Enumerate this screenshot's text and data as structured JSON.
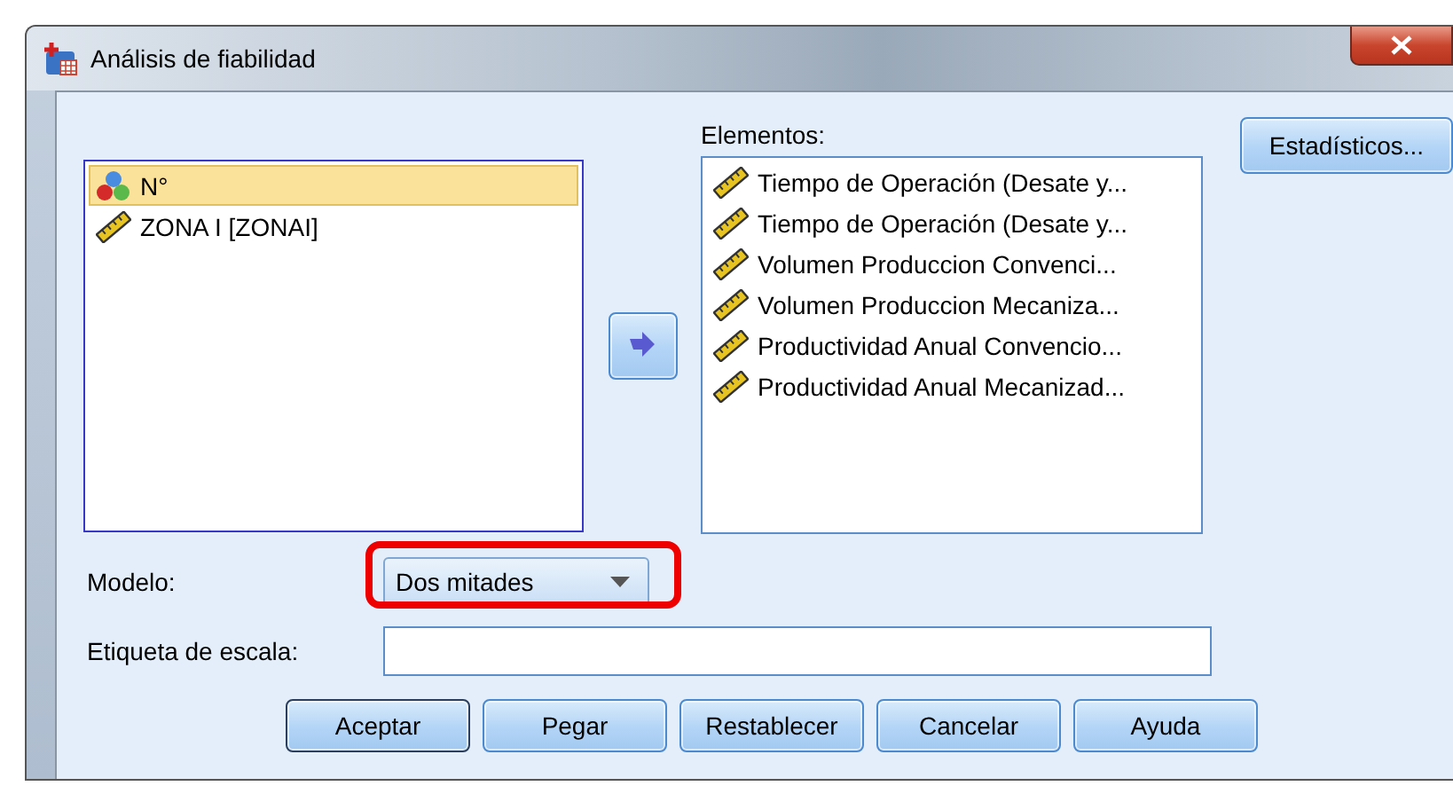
{
  "window": {
    "title": "Análisis de fiabilidad"
  },
  "variables": [
    {
      "label": "N°",
      "kind": "nominal",
      "selected": true
    },
    {
      "label": "ZONA I [ZONAI]",
      "kind": "scale",
      "selected": false
    }
  ],
  "items": {
    "label": "Elementos:",
    "entries": [
      {
        "label": "Tiempo de Operación (Desate y...",
        "kind": "scale"
      },
      {
        "label": "Tiempo de Operación (Desate y...",
        "kind": "scale"
      },
      {
        "label": "Volumen Produccion Convenci...",
        "kind": "scale"
      },
      {
        "label": "Volumen Produccion Mecaniza...",
        "kind": "scale"
      },
      {
        "label": "Productividad Anual Convencio...",
        "kind": "scale"
      },
      {
        "label": "Productividad Anual Mecanizad...",
        "kind": "scale"
      }
    ]
  },
  "statistics_button": "Estadísticos...",
  "model": {
    "label": "Modelo:",
    "value": "Dos mitades",
    "highlighted": true
  },
  "scale_label": {
    "label": "Etiqueta de escala:"
  },
  "buttons": [
    {
      "label": "Aceptar",
      "default": true
    },
    {
      "label": "Pegar",
      "default": false
    },
    {
      "label": "Restablecer",
      "default": false
    },
    {
      "label": "Cancelar",
      "default": false
    },
    {
      "label": "Ayuda",
      "default": false
    }
  ]
}
